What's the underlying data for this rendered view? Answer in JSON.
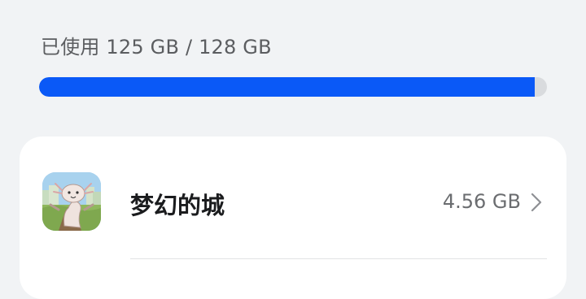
{
  "storage": {
    "used_label": "已使用 125 GB / 128 GB",
    "used_fraction": 0.9766,
    "fill_color": "#0a59f7",
    "track_color": "#d9dbde"
  },
  "app_list": [
    {
      "name": "梦幻的城",
      "size": "4.56 GB",
      "icon": "app-icon-cartoon-creature"
    }
  ]
}
